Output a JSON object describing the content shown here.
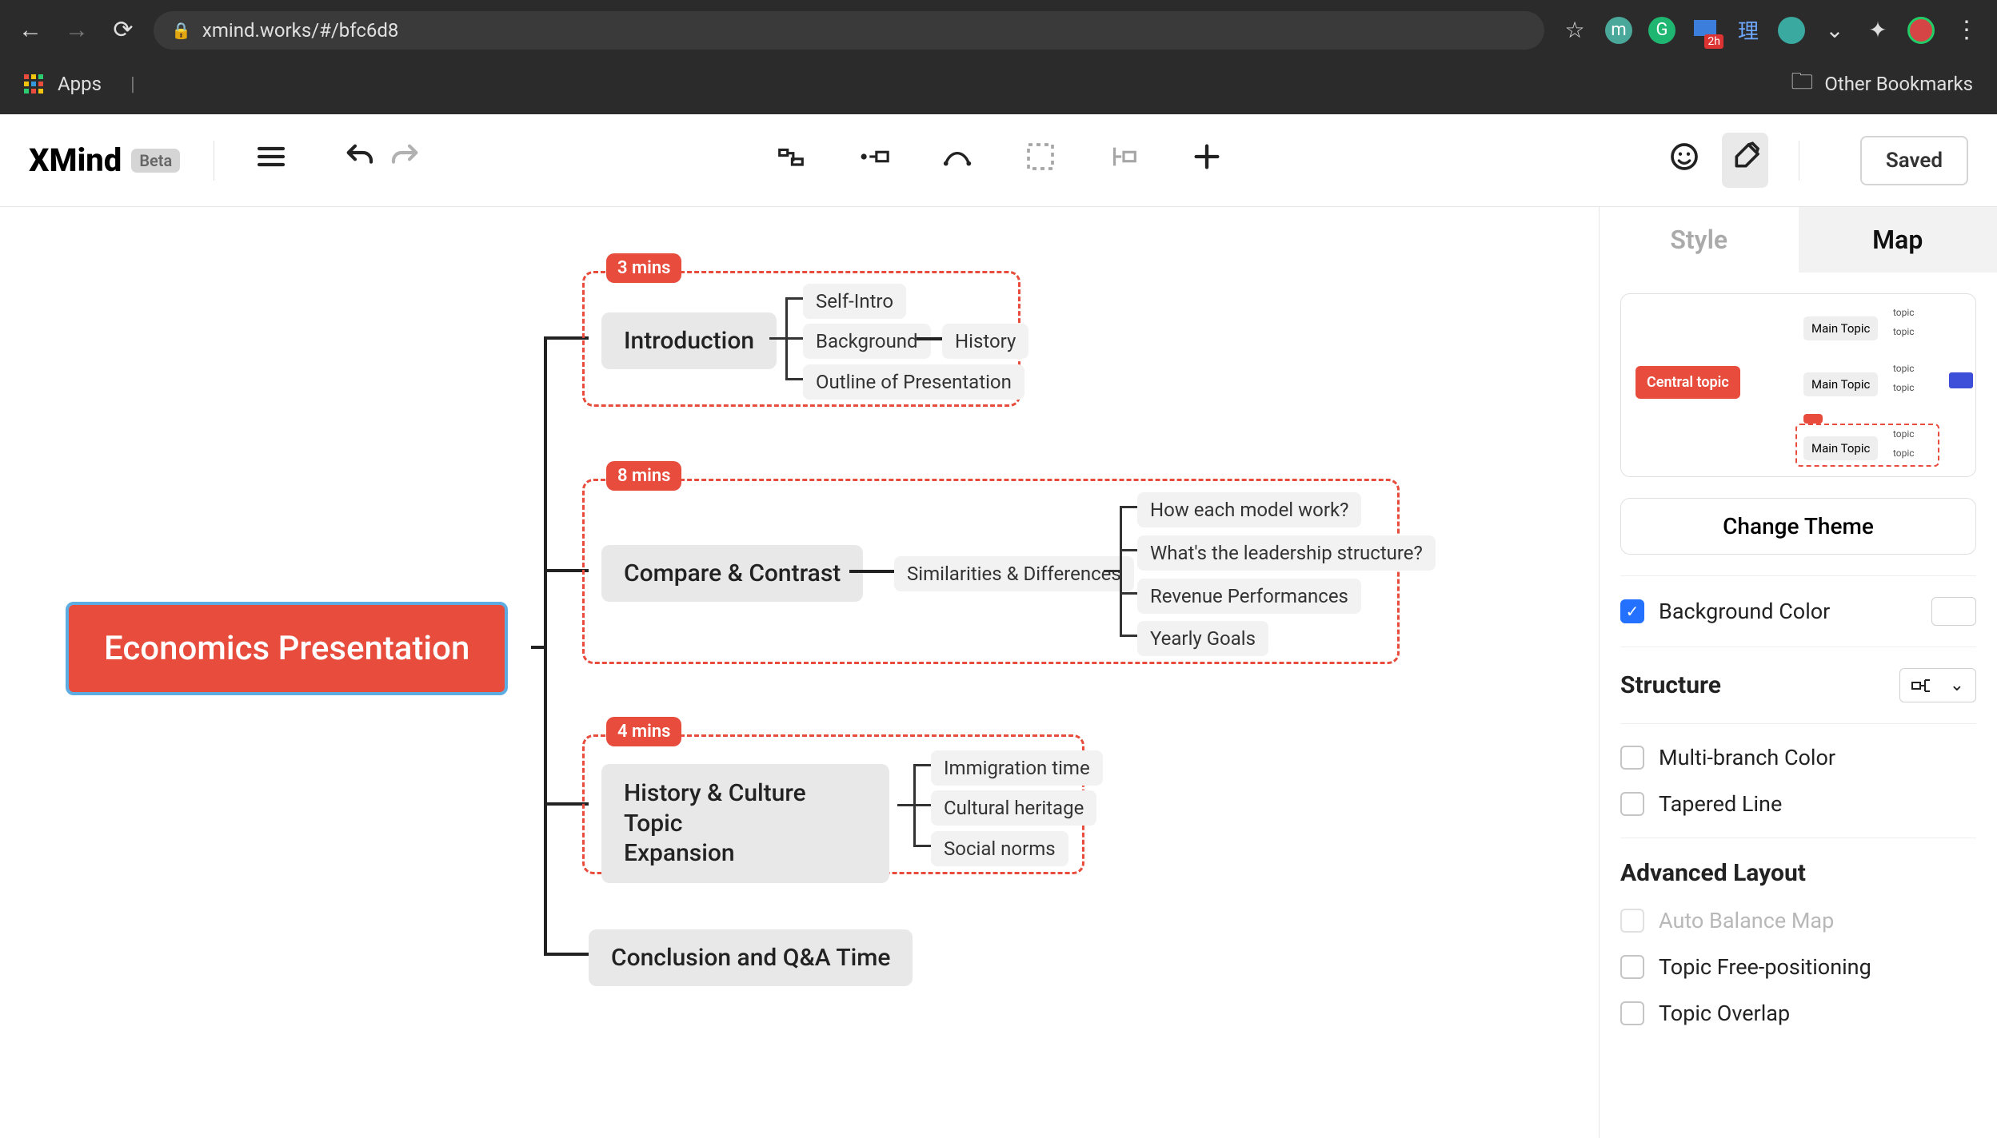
{
  "browser": {
    "url": "xmind.works/#/bfc6d8",
    "apps_label": "Apps",
    "other_bookmarks": "Other Bookmarks",
    "badge_2h": "2h"
  },
  "toolbar": {
    "logo": "XMind",
    "beta": "Beta",
    "saved": "Saved"
  },
  "mindmap": {
    "central": "Economics Presentation",
    "branches": [
      {
        "badge": "3 mins",
        "title": "Introduction",
        "children": [
          {
            "label": "Self-Intro"
          },
          {
            "label": "Background",
            "children": [
              {
                "label": "History"
              }
            ]
          },
          {
            "label": "Outline of Presentation"
          }
        ]
      },
      {
        "badge": "8 mins",
        "title": "Compare & Contrast",
        "children": [
          {
            "label": "Similarities & Differences",
            "children": [
              {
                "label": "How each model work?"
              },
              {
                "label": "What's the leadership structure?"
              },
              {
                "label": "Revenue Performances"
              },
              {
                "label": "Yearly Goals"
              }
            ]
          }
        ]
      },
      {
        "badge": "4 mins",
        "title": "History & Culture Topic\nExpansion",
        "children": [
          {
            "label": "Immigration time"
          },
          {
            "label": "Cultural heritage"
          },
          {
            "label": "Social norms"
          }
        ]
      },
      {
        "title": "Conclusion and Q&A Time"
      }
    ]
  },
  "sidebar": {
    "tabs": {
      "style": "Style",
      "map": "Map"
    },
    "preview": {
      "central": "Central topic",
      "main": "Main Topic",
      "topic": "topic"
    },
    "change_theme": "Change Theme",
    "background_color": "Background Color",
    "structure": "Structure",
    "multi_branch": "Multi-branch Color",
    "tapered": "Tapered Line",
    "advanced": "Advanced Layout",
    "auto_balance": "Auto Balance Map",
    "free_pos": "Topic Free-positioning",
    "overlap": "Topic Overlap"
  }
}
